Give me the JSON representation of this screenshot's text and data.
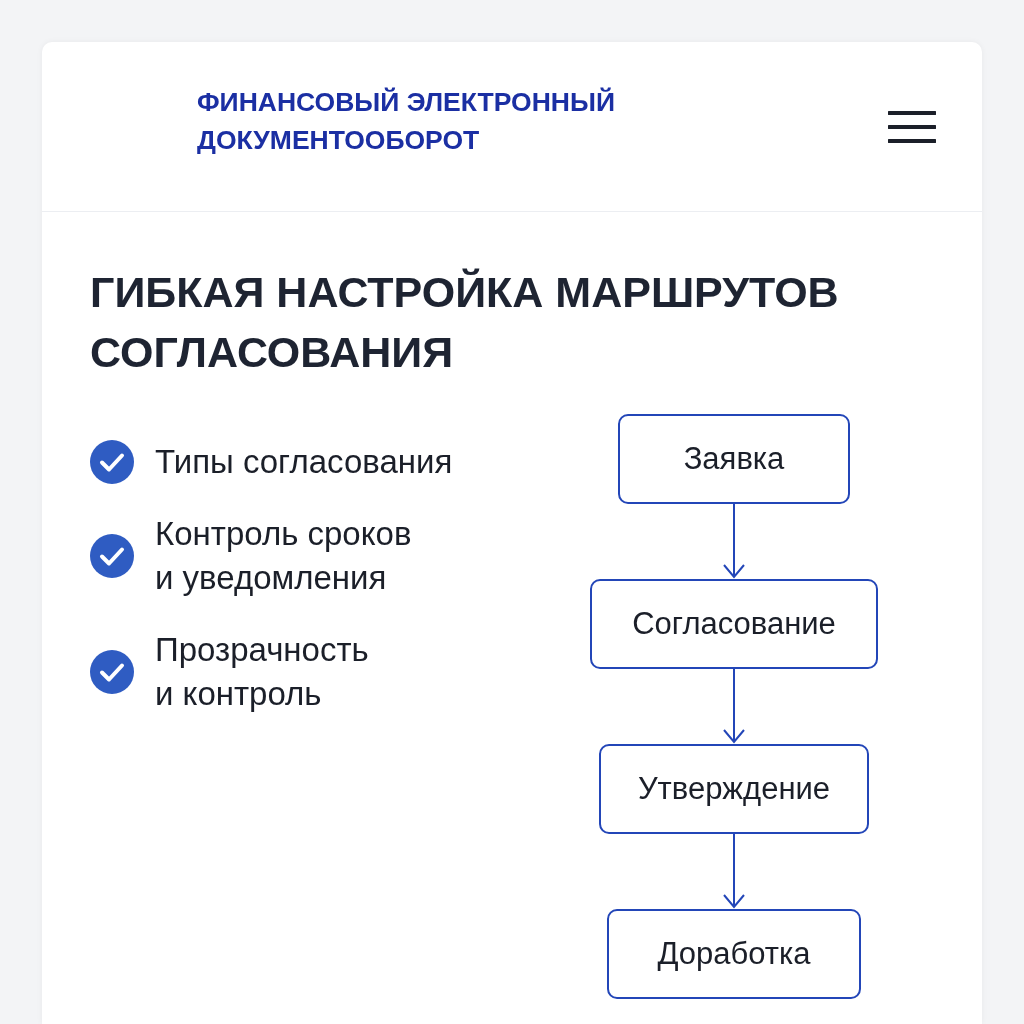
{
  "header": {
    "title": "ФИНАНСОВЫЙ ЭЛЕКТРОННЫЙ ДОКУМЕНТООБОРОТ"
  },
  "heading": "ГИБКАЯ НАСТРОЙКА МАРШРУТОВ СОГЛАСОВАНИЯ",
  "features": [
    {
      "lines": [
        "Типы согласования"
      ]
    },
    {
      "lines": [
        "Контроль сроков",
        "и уведомления"
      ]
    },
    {
      "lines": [
        "Прозрачность",
        "и контроль"
      ]
    }
  ],
  "flow": [
    {
      "label": "Заявка"
    },
    {
      "label": "Согласование"
    },
    {
      "label": "Утверждение"
    },
    {
      "label": "Доработка"
    }
  ]
}
